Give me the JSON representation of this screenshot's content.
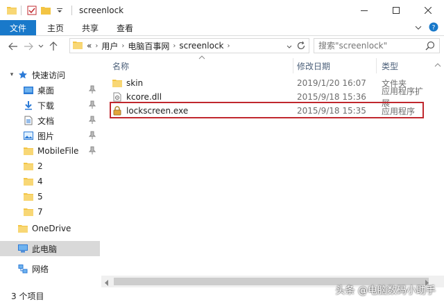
{
  "window": {
    "title": "screenlock"
  },
  "ribbon": {
    "tabs": [
      "文件",
      "主页",
      "共享",
      "查看"
    ]
  },
  "address": {
    "prefix": "«",
    "crumbs": [
      "用户",
      "电脑百事网",
      "screenlock"
    ]
  },
  "search": {
    "placeholder": "搜索\"screenlock\""
  },
  "nav": {
    "quick_access": "快速访问",
    "items": [
      {
        "label": "桌面",
        "pinned": true
      },
      {
        "label": "下载",
        "pinned": true
      },
      {
        "label": "文档",
        "pinned": true
      },
      {
        "label": "图片",
        "pinned": true
      },
      {
        "label": "MobileFile",
        "pinned": true
      },
      {
        "label": "2",
        "pinned": false
      },
      {
        "label": "4",
        "pinned": false
      },
      {
        "label": "5",
        "pinned": false
      },
      {
        "label": "7",
        "pinned": false
      }
    ],
    "onedrive": "OneDrive",
    "this_pc": "此电脑",
    "network": "网络"
  },
  "columns": {
    "name": "名称",
    "date": "修改日期",
    "type": "类型"
  },
  "files": [
    {
      "name": "skin",
      "date": "2019/1/20 16:07",
      "type": "文件夹",
      "icon": "folder-icon"
    },
    {
      "name": "kcore.dll",
      "date": "2015/9/18 15:36",
      "type": "应用程序扩展",
      "icon": "dll-file-icon"
    },
    {
      "name": "lockscreen.exe",
      "date": "2015/9/18 15:35",
      "type": "应用程序",
      "icon": "lock-app-icon"
    }
  ],
  "status": {
    "count": "3 个项目"
  },
  "watermark": "头条 @电脑数码小助手",
  "colors": {
    "file_tab": "#1979ca",
    "highlight_box": "#c0272d",
    "folder": "#f3c443",
    "selected_nav": "#d9d9d9"
  }
}
